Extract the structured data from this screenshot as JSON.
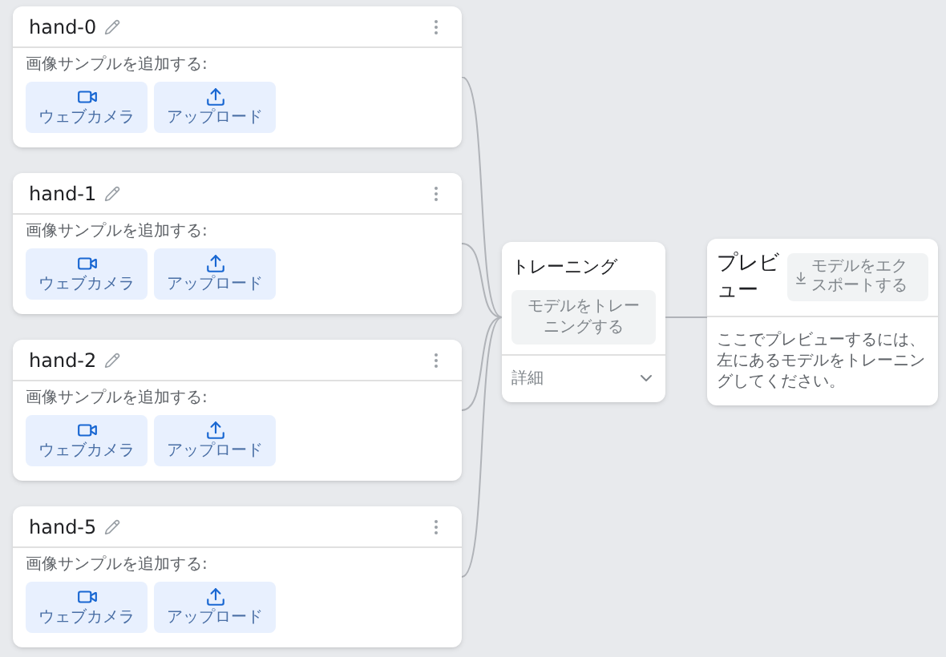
{
  "classes": [
    {
      "name": "hand-0",
      "prompt": "画像サンプルを追加する:",
      "buttons": [
        {
          "kind": "webcam",
          "label": "ウェブカメラ"
        },
        {
          "kind": "upload",
          "label": "アップロード"
        }
      ]
    },
    {
      "name": "hand-1",
      "prompt": "画像サンプルを追加する:",
      "buttons": [
        {
          "kind": "webcam",
          "label": "ウェブカメラ"
        },
        {
          "kind": "upload",
          "label": "アップロード"
        }
      ]
    },
    {
      "name": "hand-2",
      "prompt": "画像サンプルを追加する:",
      "buttons": [
        {
          "kind": "webcam",
          "label": "ウェブカメラ"
        },
        {
          "kind": "upload",
          "label": "アップロード"
        }
      ]
    },
    {
      "name": "hand-5",
      "prompt": "画像サンプルを追加する:",
      "buttons": [
        {
          "kind": "webcam",
          "label": "ウェブカメラ"
        },
        {
          "kind": "upload",
          "label": "アップロード"
        }
      ]
    }
  ],
  "training": {
    "title": "トレーニング",
    "button": "モデルをトレーニングする",
    "details": "詳細"
  },
  "preview": {
    "title": "プレビュー",
    "export_button": "モデルをエクスポートする",
    "message": "ここでプレビューするには、左にあるモデルをトレーニングしてください。"
  }
}
